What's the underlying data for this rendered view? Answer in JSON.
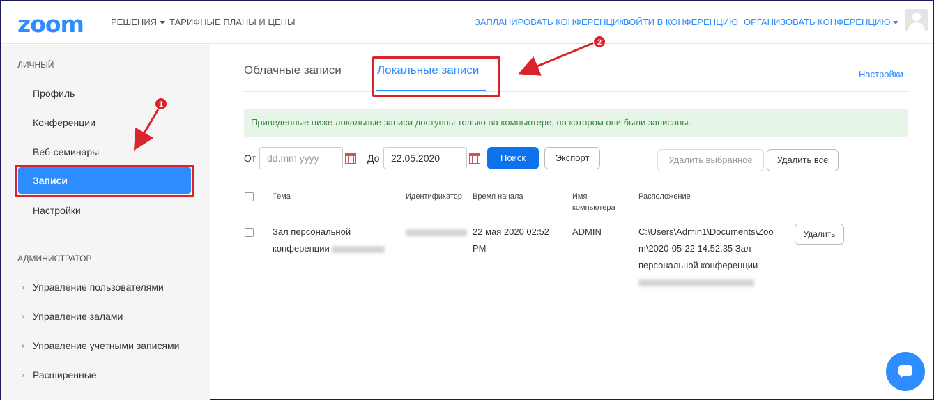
{
  "header": {
    "logo": "zoom",
    "nav_left": [
      "РЕШЕНИЯ",
      "ТАРИФНЫЕ ПЛАНЫ И ЦЕНЫ"
    ],
    "nav_right": [
      "ЗАПЛАНИРОВАТЬ КОНФЕРЕНЦИЮ",
      "ВОЙТИ В КОНФЕРЕНЦИЮ",
      "ОРГАНИЗОВАТЬ КОНФЕРЕНЦИЮ"
    ]
  },
  "sidebar": {
    "personal_title": "ЛИЧНЫЙ",
    "personal_items": [
      "Профиль",
      "Конференции",
      "Веб-семинары",
      "Записи",
      "Настройки"
    ],
    "admin_title": "АДМИНИСТРАТОР",
    "admin_items": [
      "Управление пользователями",
      "Управление залами",
      "Управление учетными записями",
      "Расширенные"
    ]
  },
  "tabs": {
    "cloud": "Облачные записи",
    "local": "Локальные записи",
    "settings": "Настройки"
  },
  "notice": "Приведенные ниже локальные записи доступны только на компьютере, на котором они были записаны.",
  "filters": {
    "from_label": "От",
    "from_placeholder": "dd.mm.yyyy",
    "to_label": "До",
    "to_value": "22.05.2020",
    "search": "Поиск",
    "export": "Экспорт",
    "delete_selected": "Удалить выбранное",
    "delete_all": "Удалить все"
  },
  "table": {
    "headers": {
      "topic": "Тема",
      "id": "Идентификатор",
      "start": "Время начала",
      "computer_line1": "Имя",
      "computer_line2": "компьютера",
      "location": "Расположение"
    },
    "row": {
      "topic_line1": "Зал персональной",
      "topic_line2": "конференции",
      "start_line1": "22 мая 2020 02:52",
      "start_line2": "PM",
      "computer": "ADMIN",
      "location_line1": "C:\\Users\\Admin1\\Documents\\Zoo",
      "location_line2": "m\\2020-05-22 14.52.35 Зал",
      "location_line3": "персональной конференции",
      "delete": "Удалить"
    }
  },
  "badges": [
    "1",
    "2"
  ],
  "colors": {
    "brand": "#2d8cff",
    "primary_button": "#0e72ed",
    "notice_bg": "#e6f5e8",
    "notice_text": "#3c8a3c",
    "annotation": "#d9232d"
  }
}
